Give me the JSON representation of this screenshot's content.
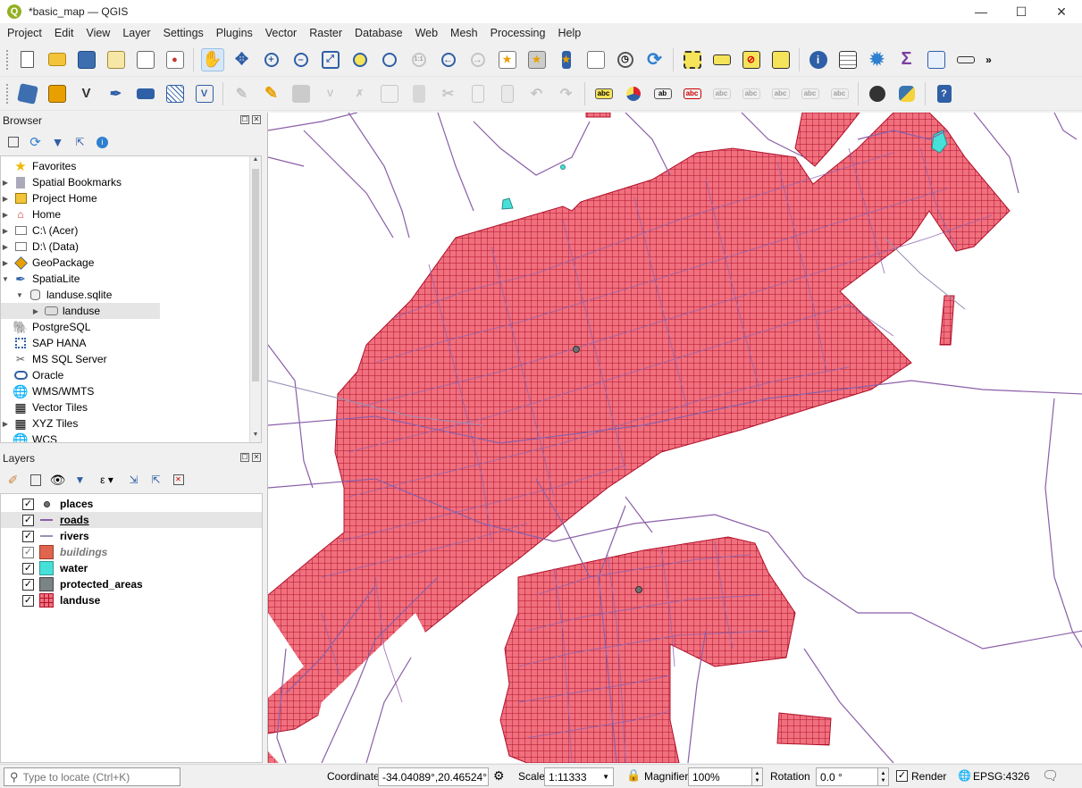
{
  "window": {
    "title": "*basic_map — QGIS",
    "app_icon": "Q"
  },
  "menu": [
    "Project",
    "Edit",
    "View",
    "Layer",
    "Settings",
    "Plugins",
    "Vector",
    "Raster",
    "Database",
    "Web",
    "Mesh",
    "Processing",
    "Help"
  ],
  "browser": {
    "title": "Browser",
    "items": [
      {
        "label": "Favorites",
        "icon": "star-icon"
      },
      {
        "label": "Spatial Bookmarks",
        "icon": "bookmark-icon"
      },
      {
        "label": "Project Home",
        "icon": "project-home-icon"
      },
      {
        "label": "Home",
        "icon": "home-icon"
      },
      {
        "label": "C:\\ (Acer)",
        "icon": "drive-icon"
      },
      {
        "label": "D:\\ (Data)",
        "icon": "drive-icon"
      },
      {
        "label": "GeoPackage",
        "icon": "geopackage-icon"
      },
      {
        "label": "SpatiaLite",
        "icon": "spatialite-icon"
      },
      {
        "label": "landuse.sqlite",
        "icon": "database-icon"
      },
      {
        "label": "landuse",
        "icon": "polygon-layer-icon"
      },
      {
        "label": "PostgreSQL",
        "icon": "postgresql-icon"
      },
      {
        "label": "SAP HANA",
        "icon": "hana-icon"
      },
      {
        "label": "MS SQL Server",
        "icon": "mssql-icon"
      },
      {
        "label": "Oracle",
        "icon": "oracle-icon"
      },
      {
        "label": "WMS/WMTS",
        "icon": "globe-icon"
      },
      {
        "label": "Vector Tiles",
        "icon": "grid-icon"
      },
      {
        "label": "XYZ Tiles",
        "icon": "grid-icon"
      },
      {
        "label": "WCS",
        "icon": "globe-icon"
      }
    ]
  },
  "layers": {
    "title": "Layers",
    "items": [
      {
        "label": "places",
        "checked": true,
        "symbol": "point",
        "color": "#707070"
      },
      {
        "label": "roads",
        "checked": true,
        "symbol": "line",
        "color": "#8a5fa8"
      },
      {
        "label": "rivers",
        "checked": true,
        "symbol": "line",
        "color": "#9b8fb5"
      },
      {
        "label": "buildings",
        "checked": true,
        "symbol": "fill",
        "color": "#e0654e"
      },
      {
        "label": "water",
        "checked": true,
        "symbol": "fill",
        "color": "#47e0d8"
      },
      {
        "label": "protected_areas",
        "checked": true,
        "symbol": "fill",
        "color": "#7a8486"
      },
      {
        "label": "landuse",
        "checked": true,
        "symbol": "hatch",
        "color": "#f0707e"
      }
    ]
  },
  "statusbar": {
    "locate_placeholder": "Type to locate (Ctrl+K)",
    "coordinate_label": "Coordinate",
    "coordinate_value": "-34.04089°,20.46524°",
    "scale_label": "Scale",
    "scale_value": "1:11333",
    "magnifier_label": "Magnifier",
    "magnifier_value": "100%",
    "rotation_label": "Rotation",
    "rotation_value": "0.0 °",
    "render_label": "Render",
    "render_checked": true,
    "crs": "EPSG:4326"
  },
  "colors": {
    "landuse_fill": "#f0707e",
    "landuse_grid": "#b0102a",
    "roads": "#8a5fa8",
    "water": "#47e0d8"
  }
}
